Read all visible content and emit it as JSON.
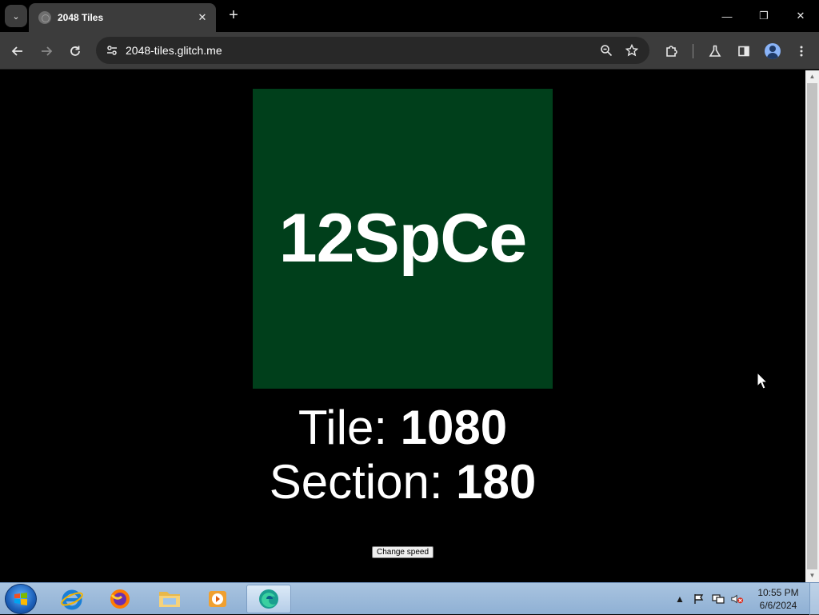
{
  "browser": {
    "tab": {
      "title": "2048 Tiles",
      "close": "✕"
    },
    "new_tab": "+",
    "window_controls": {
      "minimize": "—",
      "restore": "❐",
      "close": "✕"
    },
    "url": "2048-tiles.glitch.me"
  },
  "game": {
    "tile_text": "12SpCe",
    "tile_color": "#003f1b",
    "tile_label": "Tile: ",
    "tile_value": "1080",
    "section_label": "Section: ",
    "section_value": "180",
    "change_speed_button": "Change speed"
  },
  "taskbar": {
    "time": "10:55 PM",
    "date": "6/6/2024",
    "apps": [
      "windows-start-icon",
      "internet-explorer-icon",
      "firefox-icon",
      "file-explorer-icon",
      "media-player-icon",
      "edge-icon"
    ]
  }
}
